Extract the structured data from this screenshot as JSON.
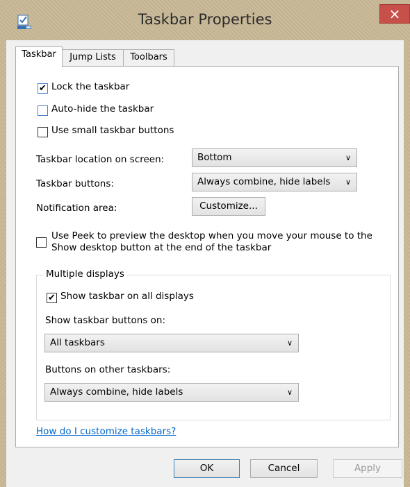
{
  "window": {
    "title": "Taskbar Properties",
    "close_label": "×",
    "icon": "taskbar-properties-icon"
  },
  "tabs": [
    {
      "label": "Taskbar",
      "active": true
    },
    {
      "label": "Jump Lists",
      "active": false
    },
    {
      "label": "Toolbars",
      "active": false
    }
  ],
  "taskbar": {
    "lock": {
      "label": "Lock the taskbar",
      "checked": true
    },
    "autohide": {
      "label": "Auto-hide the taskbar",
      "checked": false
    },
    "small_buttons": {
      "label": "Use small taskbar buttons",
      "checked": false
    },
    "location": {
      "label": "Taskbar location on screen:",
      "value": "Bottom"
    },
    "buttons": {
      "label": "Taskbar buttons:",
      "value": "Always combine, hide labels"
    },
    "notification": {
      "label": "Notification area:",
      "button": "Customize..."
    },
    "peek": {
      "line1": "Use Peek to preview the desktop when you move your mouse to the",
      "line2": "Show desktop button at the end of the taskbar",
      "checked": false
    }
  },
  "multiple_displays": {
    "title": "Multiple displays",
    "show_all": {
      "label": "Show taskbar on all displays",
      "checked": true
    },
    "show_buttons_on_label": "Show taskbar buttons on:",
    "show_buttons_on_value": "All taskbars",
    "other_buttons_label": "Buttons on other taskbars:",
    "other_buttons_value": "Always combine, hide labels"
  },
  "help_link": "How do I customize taskbars?",
  "footer": {
    "ok": "OK",
    "cancel": "Cancel",
    "apply": "Apply"
  },
  "glyphs": {
    "check": "✔",
    "chevron": "∨"
  }
}
